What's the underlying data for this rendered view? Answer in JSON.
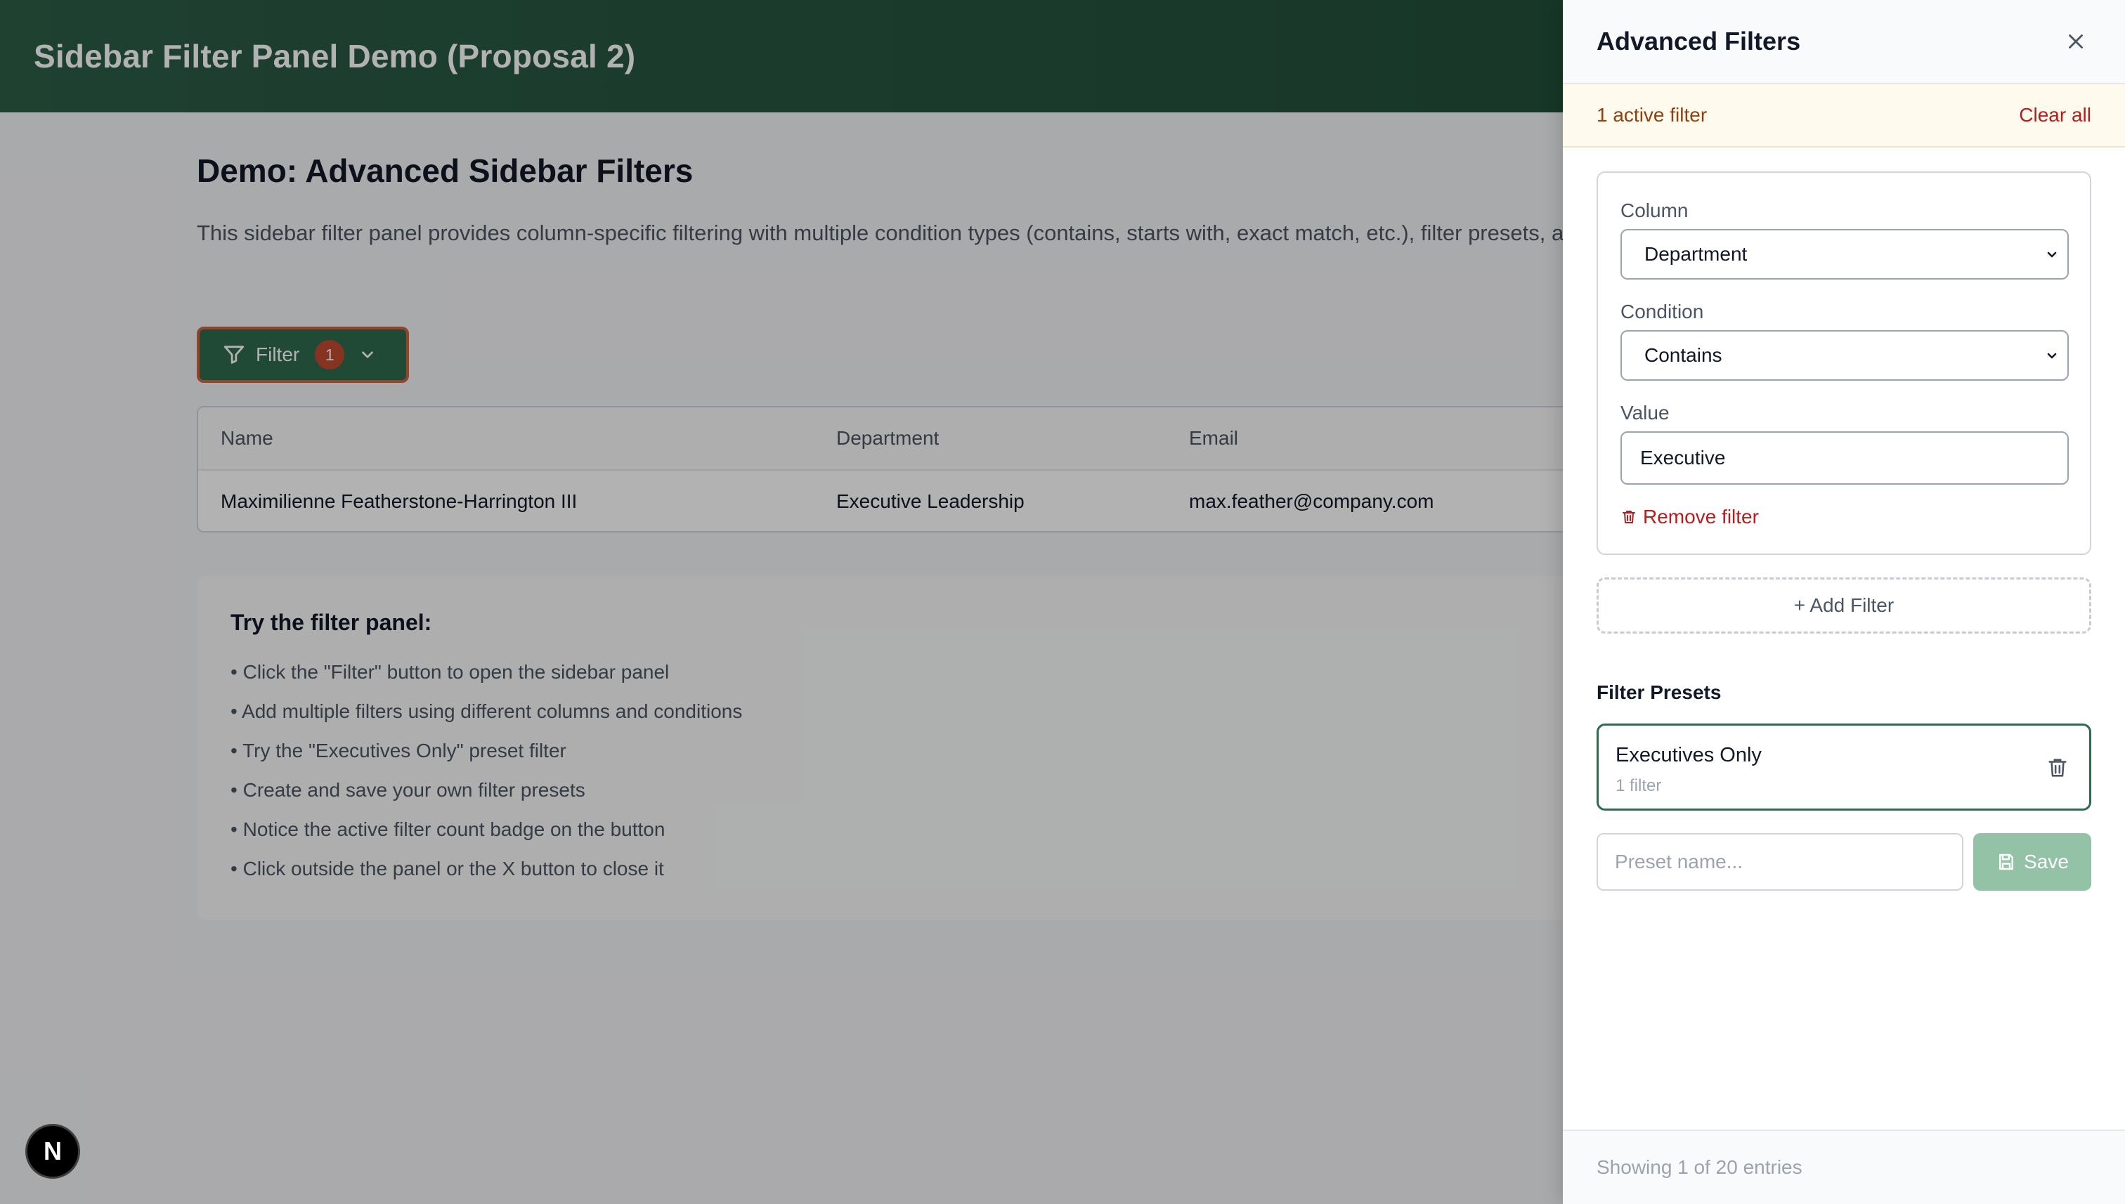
{
  "header": {
    "title": "Sidebar Filter Panel Demo (Proposal 2)"
  },
  "main": {
    "heading": "Demo: Advanced Sidebar Filters",
    "description": "This sidebar filter panel provides column-specific filtering with multiple condition types (contains, starts with, exact match, etc.), filter presets, and an intuitive interface.",
    "filter_button": {
      "label": "Filter",
      "badge": "1"
    },
    "table": {
      "headers": [
        "Name",
        "Department",
        "Email"
      ],
      "rows": [
        [
          "Maximilienne Featherstone-Harrington III",
          "Executive Leadership",
          "max.feather@company.com"
        ]
      ]
    },
    "help": {
      "title": "Try the filter panel:",
      "items": [
        "Click the \"Filter\" button to open the sidebar panel",
        "Add multiple filters using different columns and conditions",
        "Try the \"Executives Only\" preset filter",
        "Create and save your own filter presets",
        "Notice the active filter count badge on the button",
        "Click outside the panel or the X button to close it"
      ]
    }
  },
  "sidebar": {
    "title": "Advanced Filters",
    "active_count": "1 active filter",
    "clear_all": "Clear all",
    "filter": {
      "column_label": "Column",
      "column_value": "Department",
      "condition_label": "Condition",
      "condition_value": "Contains",
      "value_label": "Value",
      "value": "Executive",
      "remove": "Remove filter"
    },
    "add_filter": "+ Add Filter",
    "presets_title": "Filter Presets",
    "presets": [
      {
        "name": "Executives Only",
        "count": "1 filter"
      }
    ],
    "preset_placeholder": "Preset name...",
    "save": "Save",
    "footer": "Showing 1 of 20 entries"
  },
  "dev_badge": "N",
  "colors": {
    "header_green": "#1f4a36",
    "accent_green": "#2f6a4d",
    "badge_red": "#c24a32",
    "danger": "#b91c1c"
  }
}
